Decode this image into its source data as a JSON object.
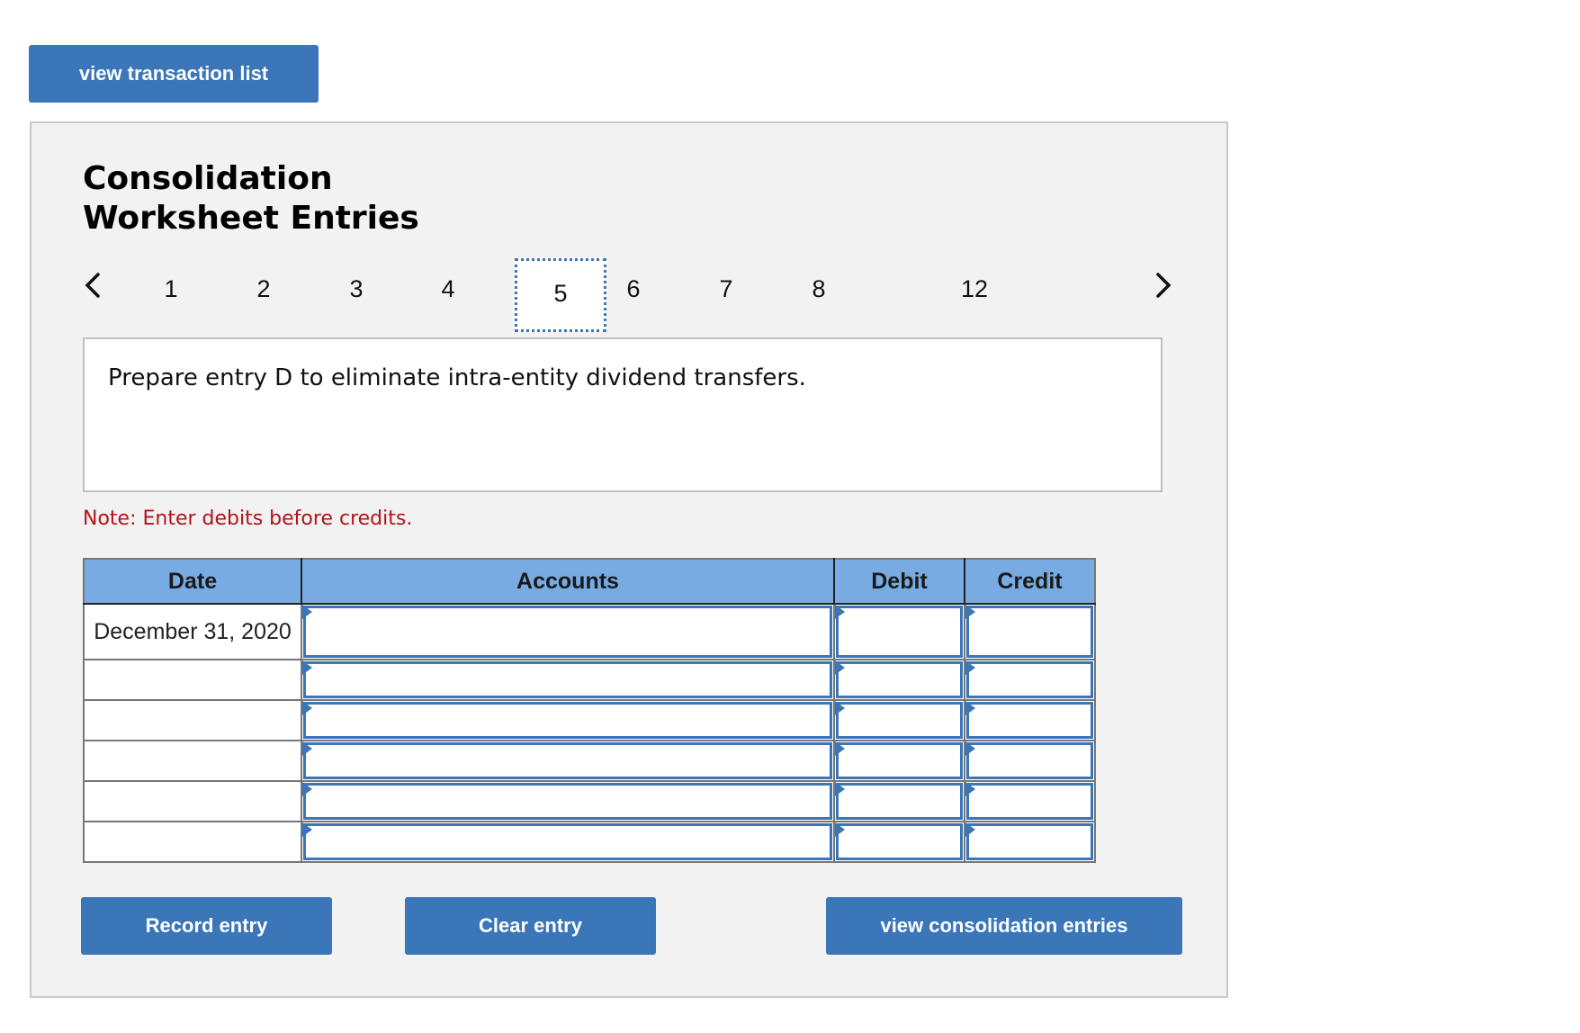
{
  "top_button": {
    "label": "view transaction list"
  },
  "panel": {
    "title_line1": "Consolidation",
    "title_line2": "Worksheet Entries",
    "pager": {
      "prev_icon": "chevron-left-icon",
      "next_icon": "chevron-right-icon",
      "pages": [
        "1",
        "2",
        "3",
        "4",
        "5",
        "6",
        "7",
        "8",
        "12"
      ],
      "active_page": "5"
    },
    "prompt": "Prepare entry D to eliminate intra-entity dividend transfers.",
    "note": "Note: Enter debits before credits.",
    "table": {
      "headers": {
        "date": "Date",
        "accounts": "Accounts",
        "debit": "Debit",
        "credit": "Credit"
      },
      "rows": [
        {
          "date": "December 31, 2020",
          "account": "",
          "debit": "",
          "credit": ""
        },
        {
          "date": "",
          "account": "",
          "debit": "",
          "credit": ""
        },
        {
          "date": "",
          "account": "",
          "debit": "",
          "credit": ""
        },
        {
          "date": "",
          "account": "",
          "debit": "",
          "credit": ""
        },
        {
          "date": "",
          "account": "",
          "debit": "",
          "credit": ""
        },
        {
          "date": "",
          "account": "",
          "debit": "",
          "credit": ""
        }
      ]
    },
    "buttons": {
      "record": "Record entry",
      "clear": "Clear entry",
      "view_consolidation": "view consolidation entries"
    }
  },
  "colors": {
    "accent": "#3a76b8",
    "header_bg": "#77abe1",
    "note": "#b3131a",
    "panel_bg": "#f2f2f2"
  }
}
